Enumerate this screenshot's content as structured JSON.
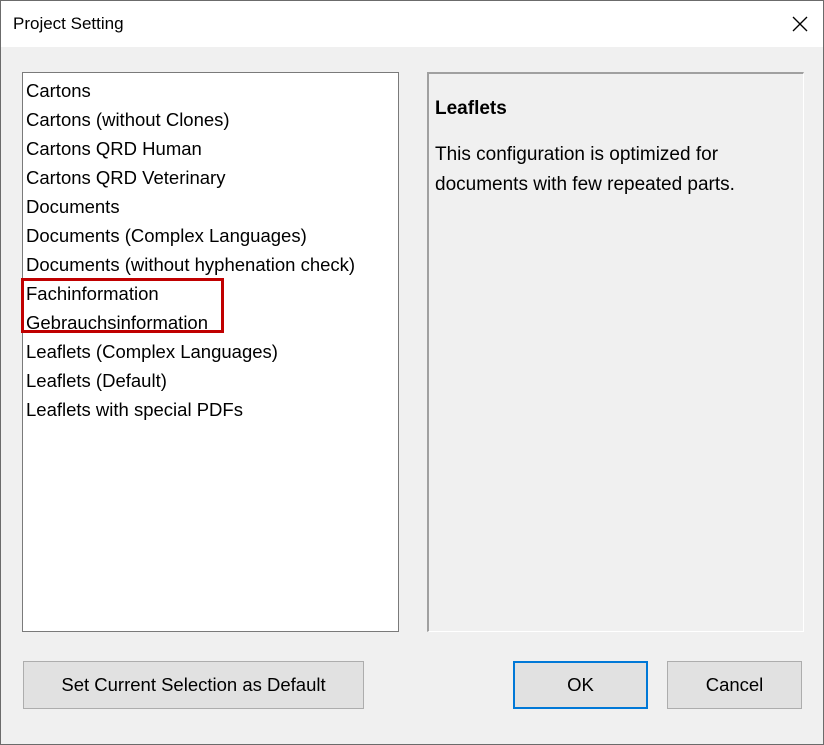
{
  "window": {
    "title": "Project Setting"
  },
  "list": {
    "items": [
      {
        "label": "Cartons"
      },
      {
        "label": "Cartons (without Clones)"
      },
      {
        "label": "Cartons QRD Human"
      },
      {
        "label": "Cartons QRD Veterinary"
      },
      {
        "label": "Documents"
      },
      {
        "label": "Documents (Complex Languages)"
      },
      {
        "label": "Documents (without hyphenation check)"
      },
      {
        "label": "Fachinformation"
      },
      {
        "label": "Gebrauchsinformation"
      },
      {
        "label": "Leaflets (Complex Languages)"
      },
      {
        "label": "Leaflets (Default)"
      },
      {
        "label": "Leaflets with special PDFs"
      }
    ]
  },
  "description": {
    "title": "Leaflets",
    "text": "This configuration is optimized for documents with few repeated parts."
  },
  "buttons": {
    "set_default": "Set Current Selection as Default",
    "ok": "OK",
    "cancel": "Cancel"
  },
  "annotation": {
    "color": "#c00000"
  }
}
